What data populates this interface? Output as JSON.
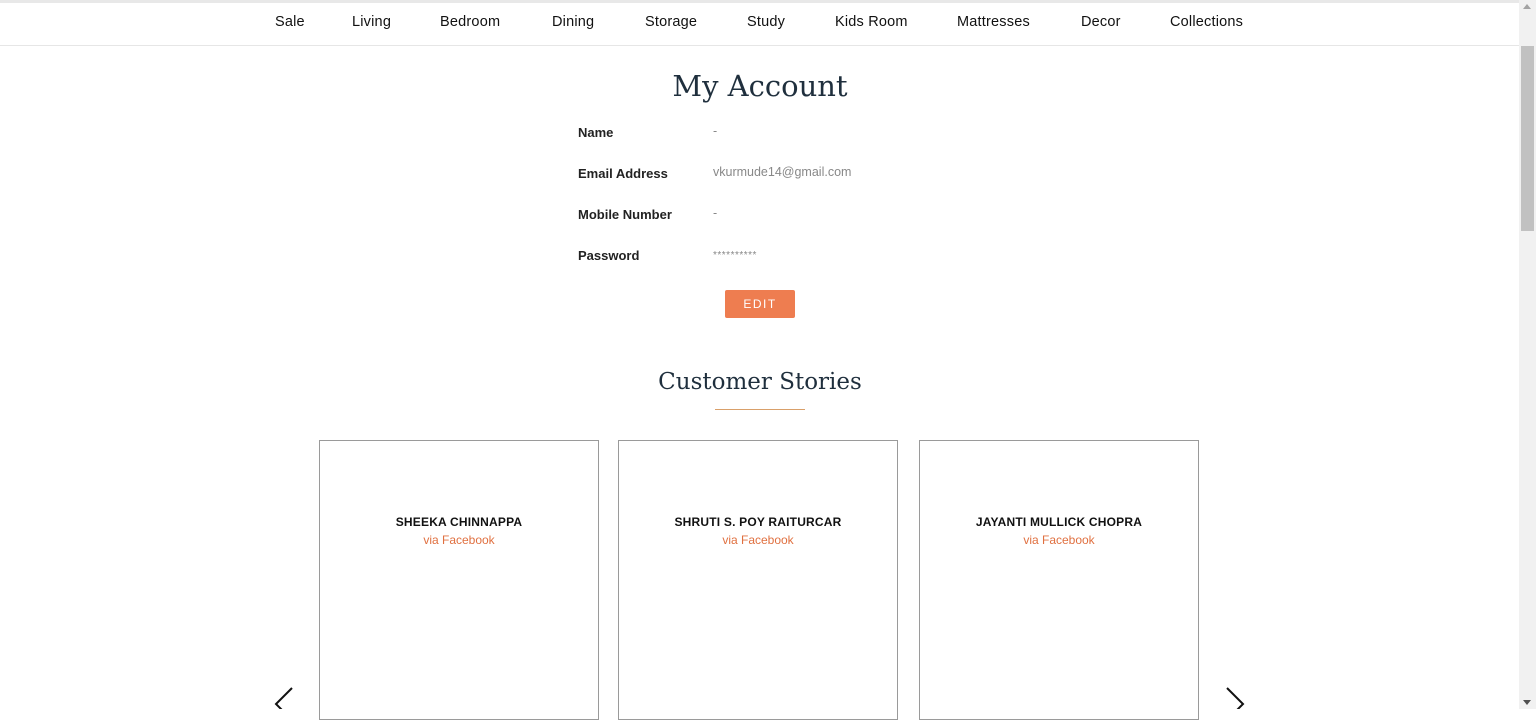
{
  "nav": {
    "items": [
      {
        "label": "Sale"
      },
      {
        "label": "Living"
      },
      {
        "label": "Bedroom"
      },
      {
        "label": "Dining"
      },
      {
        "label": "Storage"
      },
      {
        "label": "Study"
      },
      {
        "label": "Kids Room"
      },
      {
        "label": "Mattresses"
      },
      {
        "label": "Decor"
      },
      {
        "label": "Collections"
      }
    ]
  },
  "account": {
    "title": "My Account",
    "fields": [
      {
        "label": "Name",
        "value": "-"
      },
      {
        "label": "Email Address",
        "value": "vkurmude14@gmail.com"
      },
      {
        "label": "Mobile Number",
        "value": "-"
      },
      {
        "label": "Password",
        "value": "**********"
      }
    ],
    "edit_label": "EDIT"
  },
  "stories": {
    "title": "Customer Stories",
    "cards": [
      {
        "name": "SHEEKA CHINNAPPA",
        "via": "via Facebook"
      },
      {
        "name": "SHRUTI S. POY RAITURCAR",
        "via": "via Facebook"
      },
      {
        "name": "JAYANTI MULLICK CHOPRA",
        "via": "via Facebook"
      }
    ]
  },
  "colors": {
    "accent": "#ee7d50",
    "heading": "#1f2f3d",
    "via_text": "#e07040",
    "underline": "#d9a06a"
  },
  "icons": {
    "prev": "chevron-left-icon",
    "next": "chevron-right-icon"
  }
}
